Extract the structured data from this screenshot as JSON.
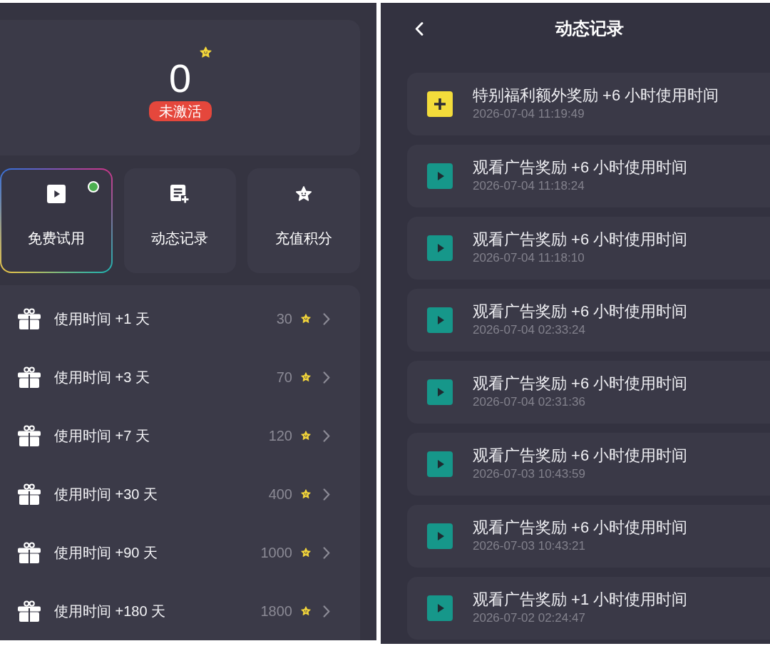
{
  "left_screen": {
    "points": {
      "value": "0",
      "status": "未激活"
    },
    "shortcuts": [
      {
        "kind": "video",
        "label": "免费试用",
        "selected": true,
        "dot": true
      },
      {
        "kind": "log",
        "label": "动态记录",
        "selected": false,
        "dot": false
      },
      {
        "kind": "points",
        "label": "充值积分",
        "selected": false,
        "dot": false
      }
    ],
    "rewards": [
      {
        "label": "使用时间 +1 天",
        "price": "30"
      },
      {
        "label": "使用时间 +3 天",
        "price": "70"
      },
      {
        "label": "使用时间 +7 天",
        "price": "120"
      },
      {
        "label": "使用时间 +30 天",
        "price": "400"
      },
      {
        "label": "使用时间 +90 天",
        "price": "1000"
      },
      {
        "label": "使用时间 +180 天",
        "price": "1800"
      }
    ]
  },
  "right_screen": {
    "header": {
      "title": "动态记录"
    },
    "records": [
      {
        "kind": "bonus",
        "title": "特别福利额外奖励 +6 小时使用时间",
        "time": "2026-07-04 11:19:49"
      },
      {
        "kind": "ad",
        "title": "观看广告奖励 +6 小时使用时间",
        "time": "2026-07-04 11:18:24"
      },
      {
        "kind": "ad",
        "title": "观看广告奖励 +6 小时使用时间",
        "time": "2026-07-04 11:18:10"
      },
      {
        "kind": "ad",
        "title": "观看广告奖励 +6 小时使用时间",
        "time": "2026-07-04 02:33:24"
      },
      {
        "kind": "ad",
        "title": "观看广告奖励 +6 小时使用时间",
        "time": "2026-07-04 02:31:36"
      },
      {
        "kind": "ad",
        "title": "观看广告奖励 +6 小时使用时间",
        "time": "2026-07-03 10:43:59"
      },
      {
        "kind": "ad",
        "title": "观看广告奖励 +6 小时使用时间",
        "time": "2026-07-03 10:43:21"
      },
      {
        "kind": "ad",
        "title": "观看广告奖励 +1 小时使用时间",
        "time": "2026-07-02 02:24:47"
      }
    ]
  }
}
